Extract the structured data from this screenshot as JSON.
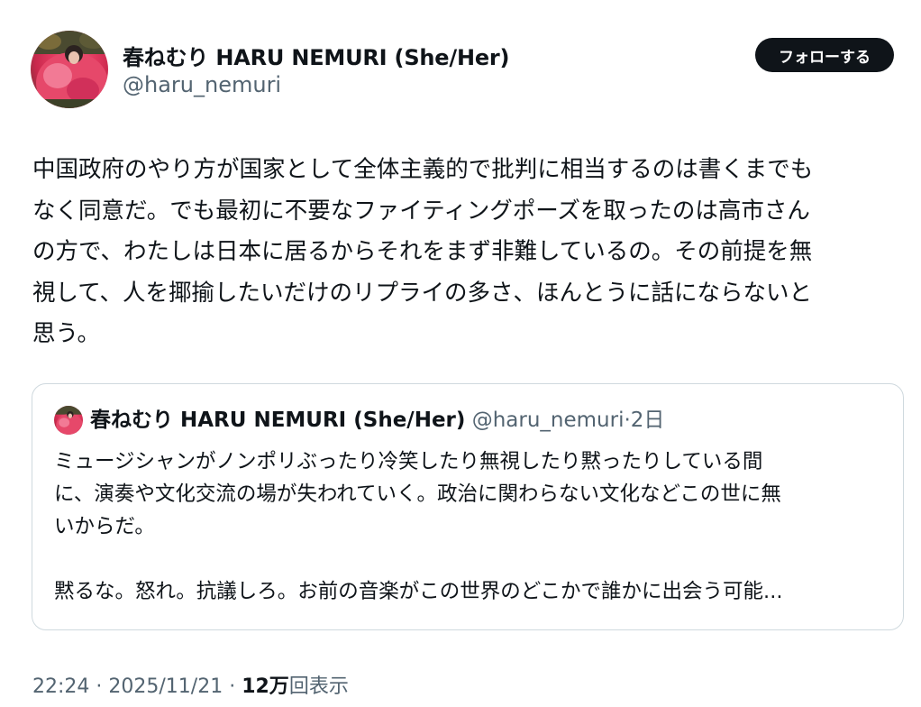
{
  "author": {
    "display_name": "春ねむり HARU NEMURI (She/Her)",
    "handle": "@haru_nemuri"
  },
  "follow_button": {
    "label": "フォローする"
  },
  "tweet": {
    "lines": [
      "中国政府のやり方が国家として全体主義的で批判に相当するのは書くまでも",
      "なく同意だ。でも最初に不要なファイティングポーズを取ったのは高市さん",
      "の方で、わたしは日本に居るからそれをまず非難しているの。その前提を無",
      "視して、人を揶揄したいだけのリプライの多さ、ほんとうに話にならないと",
      "思う。"
    ]
  },
  "quoted_tweet": {
    "display_name": "春ねむり HARU NEMURI (She/Her)",
    "handle": "@haru_nemuri",
    "separator": "·",
    "time": "2日",
    "lines": [
      "ミュージシャンがノンポリぶったり冷笑したり無視したり黙ったりしている間",
      "に、演奏や文化交流の場が失われていく。政治に関わらない文化などこの世に無",
      "いからだ。",
      "",
      "黙るな。怒れ。抗議しろ。お前の音楽がこの世界のどこかで誰かに出会う可能..."
    ]
  },
  "meta": {
    "time": "22:24",
    "sep1": " · ",
    "date": "2025/11/21",
    "sep2": " · ",
    "views_count": "12万",
    "views_label": "回表示"
  },
  "colors": {
    "text_primary": "#0f1419",
    "text_secondary": "#536471",
    "border": "#cfd9de",
    "button_bg": "#0f1419",
    "avatar_accent": "#e2395f"
  },
  "icons": {
    "avatar": "profile-avatar-image",
    "quote_avatar": "profile-avatar-image"
  }
}
